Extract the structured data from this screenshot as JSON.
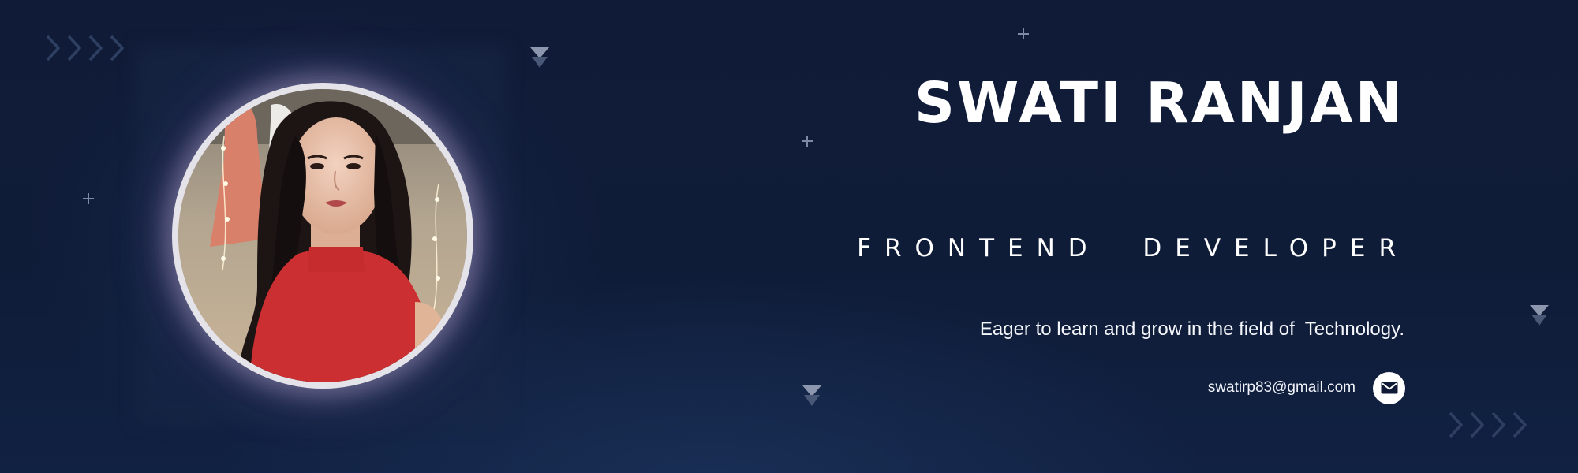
{
  "profile": {
    "name": "SWATI RANJAN",
    "role": "FRONTEND  DEVELOPER",
    "tagline": "Eager to learn and grow in the field of  Technology.",
    "email": "swatirp83@gmail.com"
  },
  "icons": {
    "mail": "mail-icon",
    "avatar": "profile-photo",
    "decorations": [
      "double-chevron-right-icon",
      "triangle-down-icon",
      "plus-icon"
    ]
  },
  "colors": {
    "background": "#0f1b36",
    "text": "#ffffff",
    "accent_glow": "#d7c3eb",
    "decor": "#7e8aa3"
  }
}
